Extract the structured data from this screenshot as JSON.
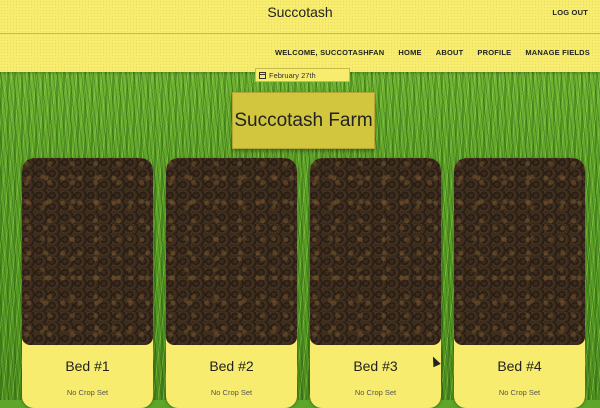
{
  "header": {
    "brand": "Succotash",
    "logout_label": "LOG OUT",
    "nav": {
      "welcome": "WELCOME, SUCCOTASHFAN",
      "home": "HOME",
      "about": "ABOUT",
      "profile": "PROFILE",
      "manage_fields": "MANAGE FIELDS"
    }
  },
  "date_chip": {
    "label": "February 27th",
    "icon": "calendar-icon"
  },
  "farm": {
    "title": "Succotash Farm"
  },
  "beds": [
    {
      "name": "Bed #1",
      "crop": "No Crop Set"
    },
    {
      "name": "Bed #2",
      "crop": "No Crop Set"
    },
    {
      "name": "Bed #3",
      "crop": "No Crop Set"
    },
    {
      "name": "Bed #4",
      "crop": "No Crop Set"
    }
  ],
  "colors": {
    "header_bg": "#f7ec6e",
    "title_bg": "#d3c63f",
    "grass": "#5fa52a",
    "soil": "#33261a"
  }
}
